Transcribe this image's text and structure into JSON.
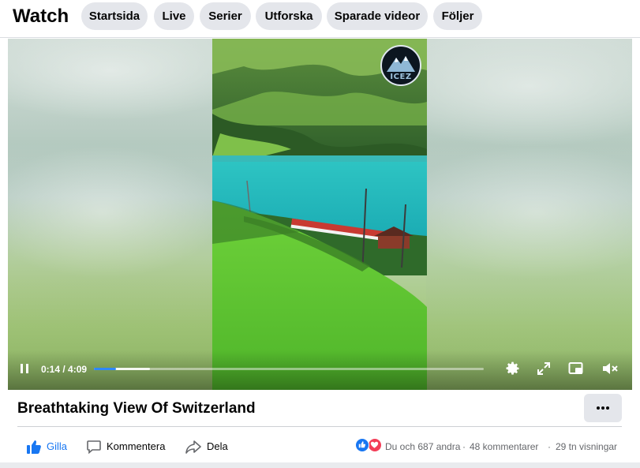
{
  "header": {
    "title": "Watch",
    "nav": [
      {
        "label": "Startsida"
      },
      {
        "label": "Live"
      },
      {
        "label": "Serier"
      },
      {
        "label": "Utforska"
      },
      {
        "label": "Sparade videor"
      },
      {
        "label": "Följer"
      }
    ]
  },
  "video": {
    "watermark": "ICEZ",
    "time": "0:14 / 4:09",
    "progress_fraction": 0.056,
    "buffered_fraction": 0.144,
    "controls": [
      "pause-icon",
      "settings-icon",
      "fullscreen-icon",
      "picture-in-picture-icon",
      "muted-volume-icon"
    ],
    "accent_color": "#2d88ff"
  },
  "post": {
    "title": "Breathtaking View Of Switzerland",
    "more_icon": "more-dots-icon"
  },
  "actions": {
    "like": "Gilla",
    "comment": "Kommentera",
    "share": "Dela"
  },
  "stats": {
    "reactions": "Du och 687 andra",
    "separator1": "·",
    "comments": "48 kommentarer",
    "separator2": "·",
    "views": "29 tn visningar"
  },
  "colors": {
    "like_blue": "#1877f2",
    "love_red": "#f33e58",
    "pill_bg": "#e4e6eb"
  }
}
